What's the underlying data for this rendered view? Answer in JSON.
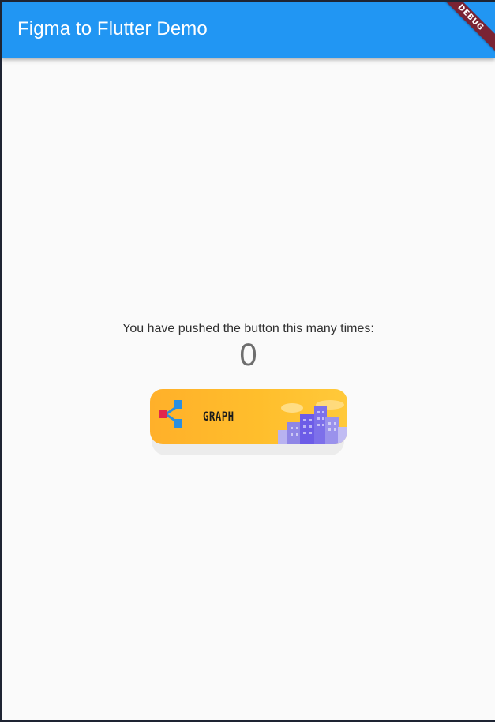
{
  "appbar": {
    "title": "Figma to Flutter Demo",
    "background": "#2196f3"
  },
  "debug_banner": {
    "label": "DEBUG",
    "color": "#7a2333"
  },
  "counter": {
    "label": "You have pushed the button this many times:",
    "value": "0"
  },
  "graph_button": {
    "label": "GRAPH",
    "icon": "graph-nodes-icon",
    "illustration": "city-buildings-illustration",
    "colors": {
      "card": "#ffbb2c",
      "node_red": "#e2264d",
      "node_blue": "#2b8fe0",
      "buildings": "#6c5ce7"
    }
  }
}
